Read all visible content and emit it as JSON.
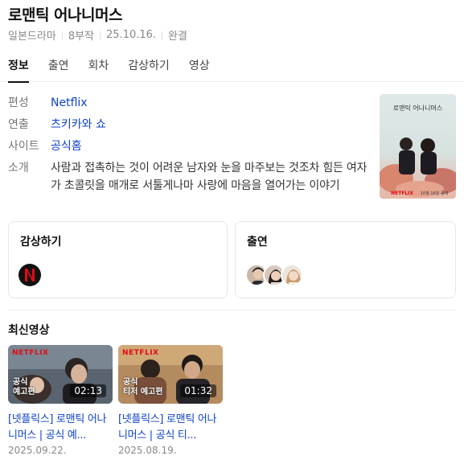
{
  "header": {
    "title": "로맨틱 어나니머스",
    "meta": [
      "일본드라마",
      "8부작",
      "25.10.16.",
      "완결"
    ]
  },
  "tabs": [
    {
      "label": "정보",
      "active": true
    },
    {
      "label": "출연",
      "active": false
    },
    {
      "label": "회차",
      "active": false
    },
    {
      "label": "감상하기",
      "active": false
    },
    {
      "label": "영상",
      "active": false
    }
  ],
  "info": {
    "rows": [
      {
        "key": "편성",
        "value": "Netflix"
      },
      {
        "key": "연출",
        "value": "츠키카와 쇼"
      },
      {
        "key": "사이트",
        "value": "공식홈"
      },
      {
        "key": "소개",
        "value": "사람과 접촉하는 것이 어려운 남자와 눈을 마주보는 것조차 힘든 여자가 초콜릿을 매개로 서툴게나마 사랑에 마음을 열어가는 이야기"
      }
    ]
  },
  "poster": {
    "title_text": "로맨틱 어나니머스",
    "badge": "NETFLIX",
    "date_text": "10월 16일 공개"
  },
  "cards": {
    "watch_title": "감상하기",
    "cast_title": "출연"
  },
  "videos": {
    "section_title": "최신영상",
    "items": [
      {
        "title": "[넷플릭스] 로맨틱 어나니머스 | 공식 예...",
        "date": "2025.09.22.",
        "duration": "02:13",
        "overlay": "공식\n예고편",
        "logo": "NETFLIX"
      },
      {
        "title": "[넷플릭스] 로맨틱 어나니머스 | 공식 티...",
        "date": "2025.08.19.",
        "duration": "01:32",
        "overlay": "공식\n티저 예고편",
        "logo": "NETFLIX"
      }
    ]
  },
  "colors": {
    "link": "#0e42c7",
    "netflix_red": "#e50914"
  }
}
